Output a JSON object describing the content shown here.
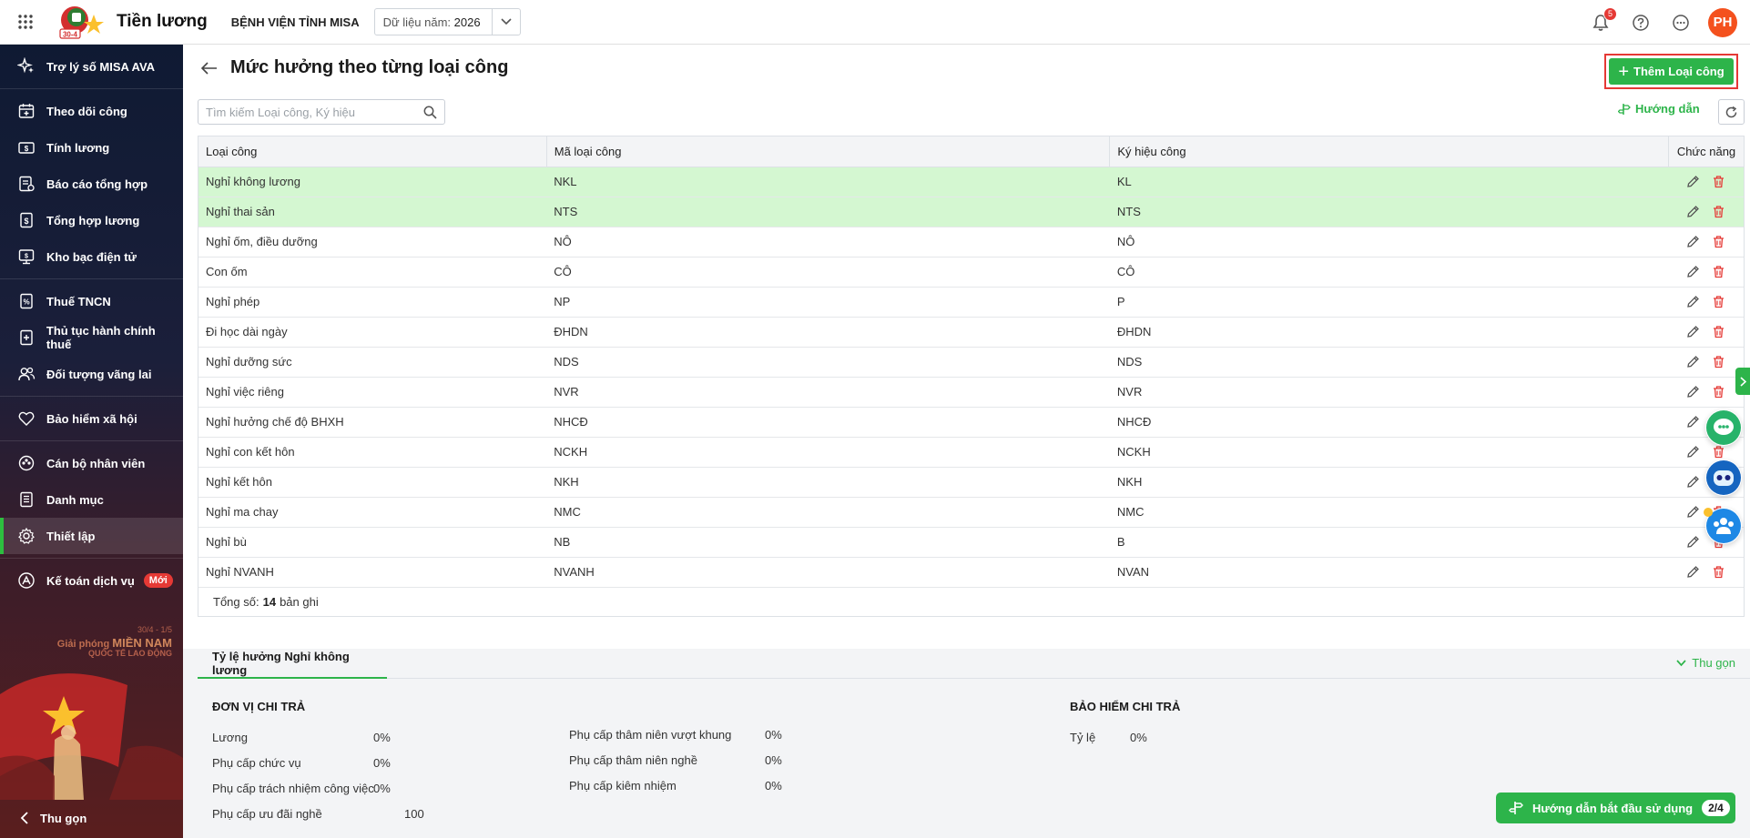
{
  "header": {
    "app_title": "Tiền lương",
    "org_name": "BỆNH VIỆN TỈNH MISA",
    "year_label": "Dữ liệu năm:",
    "year_value": "2026",
    "notification_count": "5",
    "avatar_initials": "PH"
  },
  "sidebar": {
    "items": [
      {
        "label": "Trợ lý số MISA AVA",
        "icon": "sparkle-icon"
      },
      {
        "label": "Theo dõi công",
        "icon": "calendar-icon"
      },
      {
        "label": "Tính lương",
        "icon": "money-icon"
      },
      {
        "label": "Báo cáo tổng hợp",
        "icon": "report-icon"
      },
      {
        "label": "Tổng hợp lương",
        "icon": "salary-summary-icon"
      },
      {
        "label": "Kho bạc điện tử",
        "icon": "treasury-icon"
      },
      {
        "label": "Thuế TNCN",
        "icon": "tax-icon"
      },
      {
        "label": "Thủ tục hành chính thuế",
        "icon": "tax-procedure-icon"
      },
      {
        "label": "Đối tượng vãng lai",
        "icon": "people-icon"
      },
      {
        "label": "Bảo hiểm xã hội",
        "icon": "insurance-icon"
      },
      {
        "label": "Cán bộ nhân viên",
        "icon": "staff-icon"
      },
      {
        "label": "Danh mục",
        "icon": "catalog-icon"
      },
      {
        "label": "Thiết lập",
        "icon": "gear-icon"
      },
      {
        "label": "Kế toán dịch vụ",
        "icon": "accounting-icon"
      }
    ],
    "new_tag": "Mới",
    "banner_line1": "30/4 - 1/5",
    "banner_line2_prefix": "Giải phóng",
    "banner_line2_bold": "MIỀN NAM",
    "banner_line3": "QUỐC TẾ LAO ĐỘNG",
    "collapse_label": "Thu gọn"
  },
  "page": {
    "title": "Mức hưởng theo từng loại công",
    "add_button": "Thêm Loại công",
    "search_placeholder": "Tìm kiếm Loại công, Ký hiệu",
    "guide_link": "Hướng dẫn"
  },
  "table": {
    "headers": [
      "Loại công",
      "Mã loại công",
      "Ký hiệu công",
      "Chức năng"
    ],
    "rows": [
      {
        "name": "Nghỉ không lương",
        "code": "NKL",
        "symbol": "KL",
        "highlight": true
      },
      {
        "name": "Nghỉ thai sản",
        "code": "NTS",
        "symbol": "NTS",
        "highlight": true
      },
      {
        "name": "Nghỉ ốm, điều dưỡng",
        "code": "NÔ",
        "symbol": "NÔ",
        "highlight": false
      },
      {
        "name": "Con ốm",
        "code": "CÔ",
        "symbol": "CÔ",
        "highlight": false
      },
      {
        "name": "Nghỉ phép",
        "code": "NP",
        "symbol": "P",
        "highlight": false
      },
      {
        "name": "Đi học dài ngày",
        "code": "ĐHDN",
        "symbol": "ĐHDN",
        "highlight": false
      },
      {
        "name": "Nghỉ dưỡng sức",
        "code": "NDS",
        "symbol": "NDS",
        "highlight": false
      },
      {
        "name": "Nghỉ việc riêng",
        "code": "NVR",
        "symbol": "NVR",
        "highlight": false
      },
      {
        "name": "Nghỉ hưởng chế độ BHXH",
        "code": "NHCĐ",
        "symbol": "NHCĐ",
        "highlight": false
      },
      {
        "name": "Nghỉ con kết hôn",
        "code": "NCKH",
        "symbol": "NCKH",
        "highlight": false
      },
      {
        "name": "Nghỉ kết hôn",
        "code": "NKH",
        "symbol": "NKH",
        "highlight": false
      },
      {
        "name": "Nghỉ ma chay",
        "code": "NMC",
        "symbol": "NMC",
        "highlight": false
      },
      {
        "name": "Nghỉ bù",
        "code": "NB",
        "symbol": "B",
        "highlight": false
      },
      {
        "name": "Nghỉ NVANH",
        "code": "NVANH",
        "symbol": "NVAN",
        "highlight": false
      }
    ],
    "total_label": "Tổng số:",
    "total_count": "14",
    "total_unit": "bản ghi"
  },
  "bottom": {
    "tab_label": "Tỷ lệ hưởng Nghỉ không lương",
    "collapse_label": "Thu gọn",
    "unit_pay_title": "ĐƠN VỊ CHI TRẢ",
    "insurance_title": "BẢO HIỂM CHI TRẢ",
    "col1": [
      {
        "label": "Lương",
        "value": "0%"
      },
      {
        "label": "Phụ cấp chức vụ",
        "value": "0%"
      },
      {
        "label": "Phụ cấp trách nhiệm công việc",
        "value": "0%"
      },
      {
        "label": "Phụ cấp ưu đãi nghề",
        "value": "100"
      }
    ],
    "col2": [
      {
        "label": "Phụ cấp thâm niên vượt khung",
        "value": "0%"
      },
      {
        "label": "Phụ cấp thâm niên nghề",
        "value": "0%"
      },
      {
        "label": "Phụ cấp kiêm nhiệm",
        "value": "0%"
      }
    ],
    "insurance": [
      {
        "label": "Tỷ lệ",
        "value": "0%"
      }
    ]
  },
  "floating": {
    "start_guide_label": "Hướng dẫn bắt đầu sử dụng",
    "start_guide_step": "2/4"
  },
  "colors": {
    "accent": "#2db44a",
    "highlight_row": "#d4f7d1",
    "danger": "#e53935"
  }
}
